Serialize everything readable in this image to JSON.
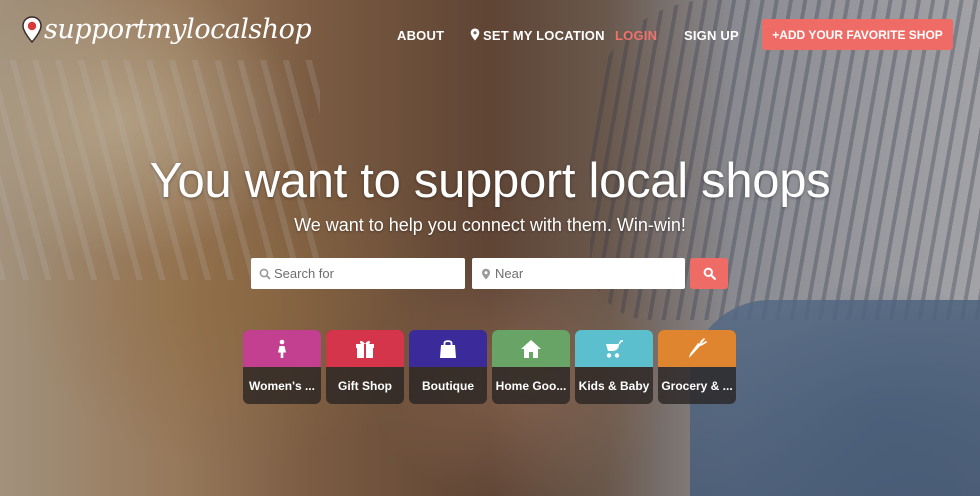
{
  "brand": {
    "logo_text": "supportmylocalshop"
  },
  "nav": {
    "about": "ABOUT",
    "set_location": "SET MY LOCATION",
    "login": "LOGIN",
    "signup": "SIGN UP",
    "add_shop": "+ADD YOUR FAVORITE SHOP"
  },
  "hero": {
    "title": "You want to support local shops",
    "subtitle": "We want to help you connect with them. Win-win!"
  },
  "search": {
    "for_placeholder": "Search for",
    "near_placeholder": "Near",
    "button_icon": "search-icon"
  },
  "categories": [
    {
      "label": "Women's ...",
      "icon": "woman-icon",
      "color": "#c2408f"
    },
    {
      "label": "Gift Shop",
      "icon": "gift-icon",
      "color": "#d4354b"
    },
    {
      "label": "Boutique",
      "icon": "shopping-bag-icon",
      "color": "#3a2a9a"
    },
    {
      "label": "Home Goo...",
      "icon": "house-icon",
      "color": "#69a467"
    },
    {
      "label": "Kids & Baby",
      "icon": "stroller-icon",
      "color": "#5bbfce"
    },
    {
      "label": "Grocery & ...",
      "icon": "carrot-icon",
      "color": "#e0852f"
    }
  ],
  "colors": {
    "accent": "#ef6b65",
    "login": "#f0716a"
  }
}
